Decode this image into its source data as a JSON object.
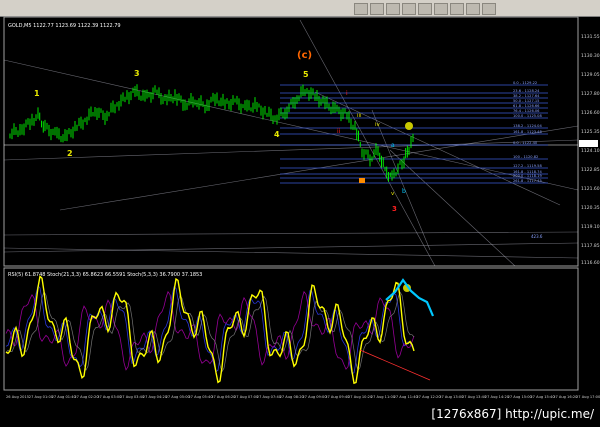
{
  "header": {
    "main": "GOLD,M5 1122.77 1123.69 1122.39 1122.79",
    "sub": "RSI(5) 61.8748 Stoch(21,3,3) 65.8623 66.5591 Stoch(5,3,3) 36.7900 37.1853"
  },
  "price_axis": [
    "1131.55",
    "1130.30",
    "1129.05",
    "1127.80",
    "1126.60",
    "1125.35",
    "1124.10",
    "1122.85",
    "1121.60",
    "1120.35",
    "1119.10",
    "1117.85",
    "1116.60"
  ],
  "time_axis": [
    "26 Aug 2015",
    "27 Aug 01:00",
    "27 Aug 01:40",
    "27 Aug 02:20",
    "27 Aug 03:00",
    "27 Aug 03:40",
    "27 Aug 04:20",
    "27 Aug 05:00",
    "27 Aug 05:40",
    "27 Aug 06:20",
    "27 Aug 07:00",
    "27 Aug 07:40",
    "27 Aug 08:20",
    "27 Aug 09:00",
    "27 Aug 09:40",
    "27 Aug 10:20",
    "27 Aug 11:00",
    "27 Aug 11:40",
    "27 Aug 12:20",
    "27 Aug 13:00",
    "27 Aug 13:40",
    "27 Aug 14:20",
    "27 Aug 15:00",
    "27 Aug 15:40",
    "27 Aug 16:20",
    "27 Aug 17:00"
  ],
  "waves": {
    "w1": "1",
    "w2": "2",
    "w3": "3",
    "w4": "4",
    "w5": "5",
    "wc": "(c)",
    "i": "i",
    "ii": "ii",
    "iii": "iii",
    "iv": "iv",
    "v": "v",
    "a": "a",
    "b": "b",
    "red3": "3"
  },
  "fib_labels": [
    "0.0 - 1129.22",
    "23.6 - 1128.24",
    "38.2 - 1127.64",
    "50.0 - 1127.15",
    "61.8 - 1126.66",
    "76.4 - 1126.06",
    "100.0 - 1125.08",
    "138.2 - 1124.04",
    "161.8 - 1123.48",
    "0.0 - 1122.40",
    "100 - 1120.82",
    "127.2 - 1119.58",
    "161.8 - 1118.74",
    "200.0 - 1118.19",
    "261.8 - 1117.45"
  ],
  "low_label": "423.6",
  "footer": "[1276x867] http://upic.me/",
  "colors": {
    "price": "#00ff00",
    "rsi": "#ffff00",
    "fib": "#3d5bd6",
    "trend": "#c0c0d0",
    "wave_yellow": "#e8e800",
    "wave_red": "#ff2020",
    "wave_orange": "#ff6600"
  }
}
